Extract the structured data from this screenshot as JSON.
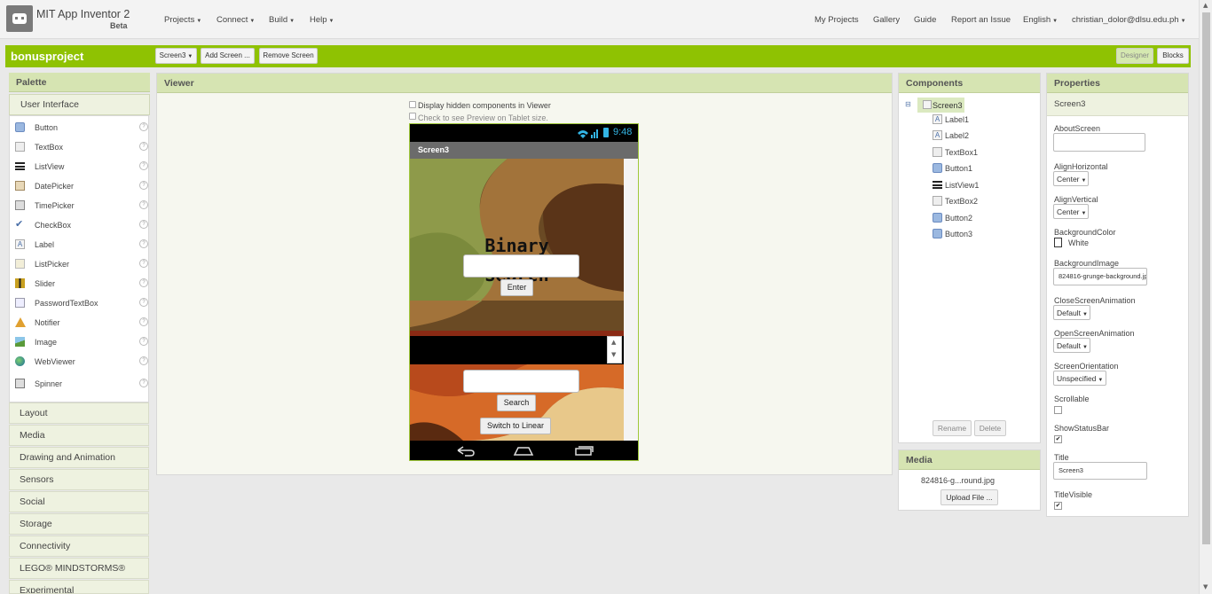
{
  "app": {
    "title": "MIT App Inventor 2",
    "beta": "Beta"
  },
  "menus": [
    {
      "label": "Projects"
    },
    {
      "label": "Connect"
    },
    {
      "label": "Build"
    },
    {
      "label": "Help"
    }
  ],
  "right_links": {
    "my_projects": "My Projects",
    "gallery": "Gallery",
    "guide": "Guide",
    "report": "Report an Issue",
    "language": "English",
    "user": "christian_dolor@dlsu.edu.ph"
  },
  "project": {
    "name": "bonusproject",
    "screen_select": "Screen3",
    "add_screen": "Add Screen ...",
    "remove_screen": "Remove Screen",
    "designer": "Designer",
    "blocks": "Blocks"
  },
  "palette": {
    "title": "Palette",
    "section": "User Interface",
    "items": [
      {
        "label": "Button",
        "icon": "button-icon"
      },
      {
        "label": "TextBox",
        "icon": "textbox-icon"
      },
      {
        "label": "ListView",
        "icon": "listview-icon"
      },
      {
        "label": "DatePicker",
        "icon": "datepicker-icon"
      },
      {
        "label": "TimePicker",
        "icon": "timepicker-icon"
      },
      {
        "label": "CheckBox",
        "icon": "checkbox-icon"
      },
      {
        "label": "Label",
        "icon": "label-icon"
      },
      {
        "label": "ListPicker",
        "icon": "listpicker-icon"
      },
      {
        "label": "Slider",
        "icon": "slider-icon"
      },
      {
        "label": "PasswordTextBox",
        "icon": "password-icon"
      },
      {
        "label": "Notifier",
        "icon": "notifier-icon"
      },
      {
        "label": "Image",
        "icon": "image-icon"
      },
      {
        "label": "WebViewer",
        "icon": "webviewer-icon"
      },
      {
        "label": "Spinner",
        "icon": "spinner-icon"
      }
    ],
    "help": "?",
    "categories": [
      "Layout",
      "Media",
      "Drawing and Animation",
      "Sensors",
      "Social",
      "Storage",
      "Connectivity",
      "LEGO® MINDSTORMS®",
      "Experimental"
    ]
  },
  "viewer": {
    "title": "Viewer",
    "hidden_label": "Display hidden components in Viewer",
    "tablet_label": "Check to see Preview on Tablet size."
  },
  "phone": {
    "time": "9:48",
    "screen_title": "Screen3",
    "heading_line1": "Binary",
    "heading_line2": "Search",
    "enter_button": "Enter",
    "search_button": "Search",
    "switch_button": "Switch to Linear"
  },
  "components": {
    "title": "Components",
    "collapse": "⊟",
    "root": "Screen3",
    "children": [
      {
        "label": "Label1",
        "icon": "label-icon"
      },
      {
        "label": "Label2",
        "icon": "label-icon"
      },
      {
        "label": "TextBox1",
        "icon": "textbox-icon"
      },
      {
        "label": "Button1",
        "icon": "button-icon"
      },
      {
        "label": "ListView1",
        "icon": "listview-icon"
      },
      {
        "label": "TextBox2",
        "icon": "textbox-icon"
      },
      {
        "label": "Button2",
        "icon": "button-icon"
      },
      {
        "label": "Button3",
        "icon": "button-icon"
      }
    ],
    "rename": "Rename",
    "delete": "Delete"
  },
  "media": {
    "title": "Media",
    "file": "824816-g...round.jpg",
    "upload": "Upload File ..."
  },
  "properties": {
    "title": "Properties",
    "component": "Screen3",
    "about_label": "AboutScreen",
    "align_h_label": "AlignHorizontal",
    "align_h_value": "Center",
    "align_v_label": "AlignVertical",
    "align_v_value": "Center",
    "bgcolor_label": "BackgroundColor",
    "bgcolor_value": "White",
    "bgimage_label": "BackgroundImage",
    "bgimage_value": "824816-grunge-background.jp",
    "close_anim_label": "CloseScreenAnimation",
    "close_anim_value": "Default",
    "open_anim_label": "OpenScreenAnimation",
    "open_anim_value": "Default",
    "orientation_label": "ScreenOrientation",
    "orientation_value": "Unspecified",
    "scrollable_label": "Scrollable",
    "scrollable_checked": false,
    "statusbar_label": "ShowStatusBar",
    "statusbar_checked": true,
    "title_label": "Title",
    "title_value": "Screen3",
    "titlevisible_label": "TitleVisible",
    "titlevisible_checked": true
  },
  "colors": {
    "accent": "#8fc202",
    "panel_head": "#d6e4b2"
  }
}
